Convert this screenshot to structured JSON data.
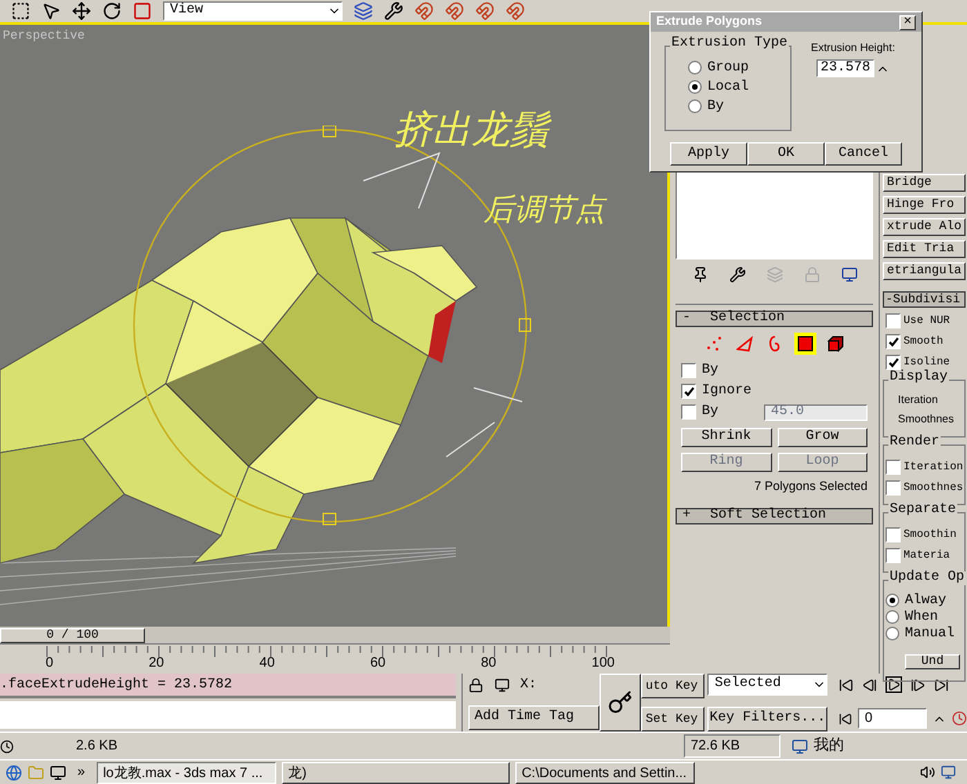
{
  "toolbar": {
    "view_dropdown": "View"
  },
  "viewport": {
    "label": "Perspective",
    "annotations": [
      "挤出龙鬚",
      "后调节点"
    ]
  },
  "dialog": {
    "title": "Extrude Polygons",
    "close": "×",
    "group_title": "Extrusion Type",
    "options": [
      {
        "label": "Group",
        "selected": false
      },
      {
        "label": "Local",
        "selected": true
      },
      {
        "label": "By",
        "selected": false
      }
    ],
    "height_label": "Extrusion Height:",
    "height_value": "23.578",
    "buttons": [
      "Apply",
      "OK",
      "Cancel"
    ]
  },
  "command_panel": {
    "selection": {
      "title": "Selection",
      "collapse_sign": "-",
      "levels": [
        {
          "kind": "vertex",
          "selected": false
        },
        {
          "kind": "edge",
          "selected": false
        },
        {
          "kind": "border",
          "selected": false
        },
        {
          "kind": "polygon",
          "selected": true
        },
        {
          "kind": "element",
          "selected": false
        }
      ],
      "options": [
        {
          "label": "By",
          "checked": false
        },
        {
          "label": "Ignore",
          "checked": true
        },
        {
          "label": "By",
          "checked": false,
          "value": "45.0"
        }
      ],
      "buttons": [
        {
          "label": "Shrink",
          "disabled": false
        },
        {
          "label": "Grow",
          "disabled": false
        },
        {
          "label": "Ring",
          "disabled": true
        },
        {
          "label": "Loop",
          "disabled": true
        }
      ],
      "status": "7 Polygons Selected"
    },
    "soft_selection": {
      "title": "Soft Selection",
      "collapse_sign": "+"
    },
    "edit_buttons": [
      "Bridge",
      "Hinge Fro",
      "xtrude Alo",
      "Edit Tria",
      "etriangula"
    ],
    "subdivision": {
      "title": "Subdivisi",
      "collapse_sign": "-",
      "checks": [
        {
          "label": "Use NUR",
          "checked": false
        },
        {
          "label": "Smooth",
          "checked": true
        },
        {
          "label": "Isoline",
          "checked": true
        }
      ],
      "display": {
        "title": "Display",
        "labels": [
          "Iteration",
          "Smoothnes"
        ]
      },
      "render": {
        "title": "Render",
        "checks": [
          {
            "label": "Iteration",
            "checked": false
          },
          {
            "label": "Smoothnes",
            "checked": false
          }
        ]
      },
      "separate": {
        "title": "Separate",
        "checks": [
          {
            "label": "Smoothin",
            "checked": false
          },
          {
            "label": "Materia",
            "checked": false
          }
        ]
      },
      "update": {
        "title": "Update Op",
        "options": [
          {
            "label": "Alway",
            "selected": true
          },
          {
            "label": "When",
            "selected": false
          },
          {
            "label": "Manual",
            "selected": false
          }
        ],
        "button": "Und"
      }
    }
  },
  "timeline": {
    "frame_range": "0 / 100",
    "ticks": [
      "0",
      "20",
      "40",
      "60",
      "80",
      "100"
    ]
  },
  "script_line": ".faceExtrudeHeight = 23.5782",
  "keying": {
    "x_label": "X:",
    "add_time_tag": "Add Time Tag",
    "auto_key": "uto Key",
    "set_key": "Set Key",
    "key_mode": "Selected",
    "key_filters": "Key Filters...",
    "frame": "0"
  },
  "status": {
    "left": "2.6 KB",
    "right": "72.6 KB",
    "computer": "我的"
  },
  "taskbar": {
    "chevron": "»",
    "tasks": [
      {
        "label": "lo龙教.max - 3ds max 7 ...",
        "selected": true
      },
      {
        "label": "龙)",
        "selected": false
      },
      {
        "label": "C:\\Documents and Settin...",
        "selected": false
      }
    ]
  }
}
